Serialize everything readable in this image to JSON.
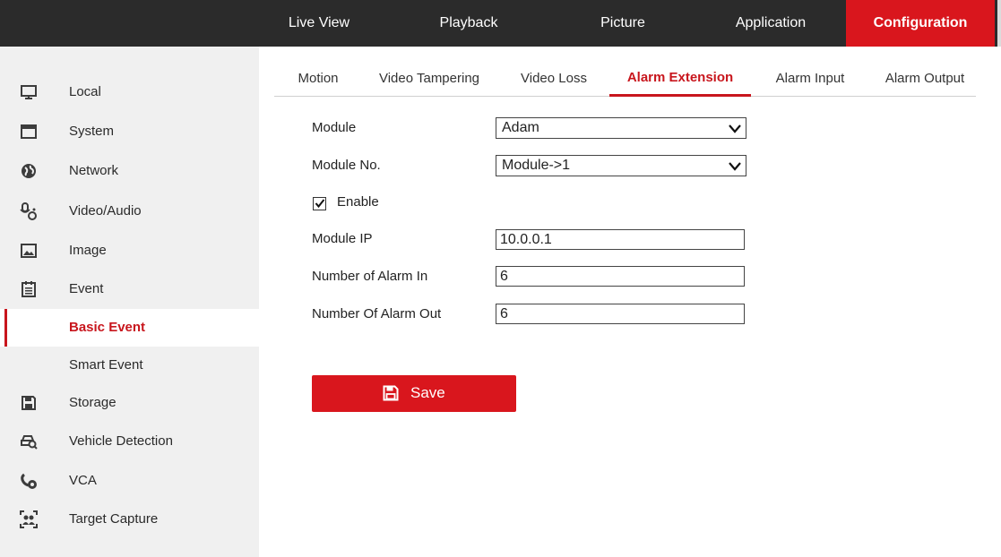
{
  "topnav": {
    "items": [
      {
        "label": "Live View"
      },
      {
        "label": "Playback"
      },
      {
        "label": "Picture"
      },
      {
        "label": "Application"
      },
      {
        "label": "Configuration"
      }
    ]
  },
  "sidebar": {
    "items": [
      {
        "label": "Local",
        "icon": "monitor-icon"
      },
      {
        "label": "System",
        "icon": "window-icon"
      },
      {
        "label": "Network",
        "icon": "globe-icon"
      },
      {
        "label": "Video/Audio",
        "icon": "camera-mic-icon"
      },
      {
        "label": "Image",
        "icon": "image-icon"
      },
      {
        "label": "Event",
        "icon": "calendar-icon"
      },
      {
        "label": "Basic Event",
        "icon": ""
      },
      {
        "label": "Smart Event",
        "icon": ""
      },
      {
        "label": "Storage",
        "icon": "floppy-icon"
      },
      {
        "label": "Vehicle Detection",
        "icon": "vehicle-search-icon"
      },
      {
        "label": "VCA",
        "icon": "vca-icon"
      },
      {
        "label": "Target Capture",
        "icon": "target-capture-icon"
      }
    ]
  },
  "tabs": [
    {
      "label": "Motion"
    },
    {
      "label": "Video Tampering"
    },
    {
      "label": "Video Loss"
    },
    {
      "label": "Alarm Extension"
    },
    {
      "label": "Alarm Input"
    },
    {
      "label": "Alarm Output"
    }
  ],
  "form": {
    "module_label": "Module",
    "module_value": "Adam",
    "module_no_label": "Module No.",
    "module_no_value": "Module->1",
    "enable_label": "Enable",
    "enable_checked": true,
    "module_ip_label": "Module IP",
    "module_ip_value": "10.0.0.1",
    "alarm_in_label": "Number of Alarm In",
    "alarm_in_value": "6",
    "alarm_out_label": "Number Of Alarm Out",
    "alarm_out_value": "6"
  },
  "save_button": {
    "label": "Save",
    "icon": "save-icon"
  },
  "colors": {
    "accent": "#d9161d",
    "topbar": "#2b2b2b",
    "sidebar": "#f0f0f0"
  }
}
